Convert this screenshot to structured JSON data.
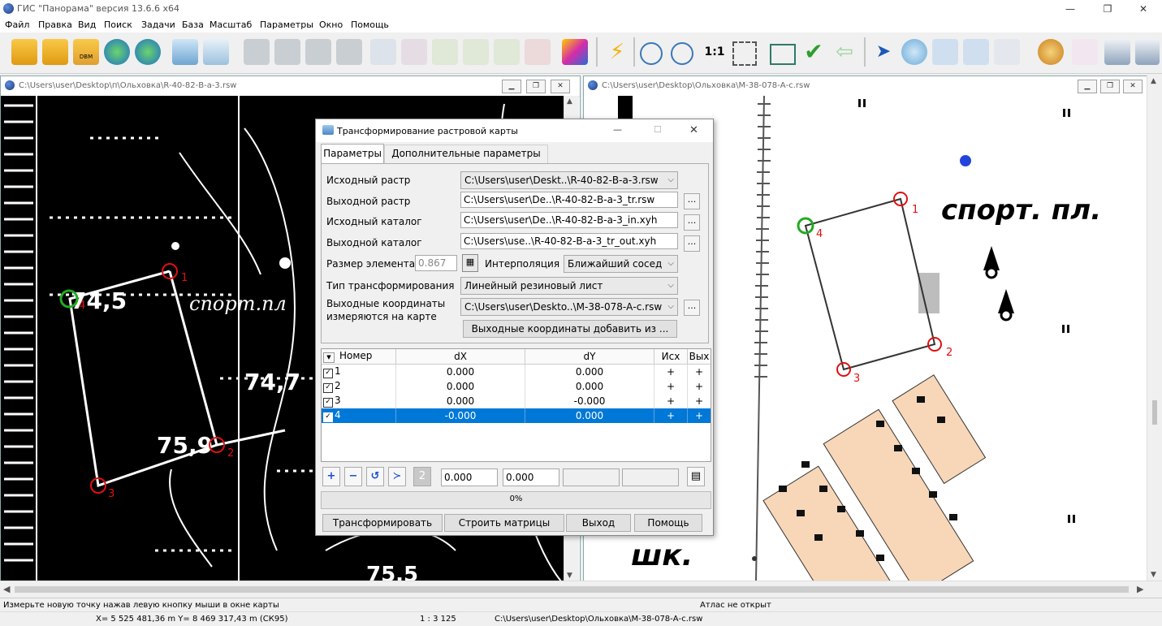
{
  "window": {
    "title": "ГИС \"Панорама\" версия 13.6.6 x64",
    "controls": [
      "—",
      "❐",
      "✕"
    ]
  },
  "menu": [
    "Файл",
    "Правка",
    "Вид",
    "Поиск",
    "Задачи",
    "База",
    "Масштаб",
    "Параметры",
    "Окно",
    "Помощь"
  ],
  "toolbar": {
    "scale_label": "1:1",
    "icons": [
      "open-folder-icon",
      "open-project-icon",
      "dbm-icon",
      "globe-refresh-icon",
      "globe-add-icon",
      "layers-icon",
      "tree-list-icon",
      "binoculars-icon",
      "binoculars-a-icon",
      "binoculars-dots-icon",
      "binoculars-2-icon",
      "list-icon",
      "select-object-icon",
      "select-move-icon",
      "add-point-icon",
      "edit-object-icon",
      "delete-object-icon",
      "cube-icon",
      "lightning-icon",
      "zoom-out-icon",
      "zoom-in-icon",
      "zoom-frame-icon",
      "window-icon",
      "check-icon",
      "back-arrow-icon",
      "pointer-icon",
      "globe-map-icon",
      "frame-list-icon",
      "dbm-frame-icon",
      "text-frame-icon",
      "palette-icon",
      "route-icon",
      "print-icon",
      "print2-icon"
    ]
  },
  "left_window": {
    "title": "C:\\Users\\user\\Desktop\\п\\Ольховка\\R-40-82-В-а-3.rsw",
    "labels": [
      "74,5",
      "74,7",
      "75,9",
      "спорт.пл",
      "75.5"
    ],
    "point_labels": [
      "1",
      "2",
      "3",
      "4"
    ]
  },
  "right_window": {
    "title": "C:\\Users\\user\\Desktop\\Ольховка\\M-38-078-А-с.rsw",
    "labels": [
      "спорт. пл.",
      "шк."
    ],
    "point_labels": [
      "1",
      "2",
      "3",
      "4"
    ]
  },
  "dialog": {
    "title": "Трансформирование растровой карты",
    "controls": [
      "—",
      "☐",
      "✕"
    ],
    "tabs": [
      "Параметры",
      "Дополнительные параметры"
    ],
    "rows": {
      "src_raster_label": "Исходный растр",
      "src_raster_value": "C:\\Users\\user\\Deskt..\\R-40-82-В-а-3.rsw",
      "out_raster_label": "Выходной растр",
      "out_raster_value": "C:\\Users\\user\\De..\\R-40-82-В-а-3_tr.rsw",
      "src_catalog_label": "Исходный каталог",
      "src_catalog_value": "C:\\Users\\user\\De..\\R-40-82-В-а-3_in.xyh",
      "out_catalog_label": "Выходной каталог",
      "out_catalog_value": "C:\\Users\\use..\\R-40-82-В-а-3_tr_out.xyh",
      "elem_size_label": "Размер элемента",
      "elem_size_value": "0.867",
      "interp_label": "Интерполяция",
      "interp_value": "Ближайший сосед",
      "transform_type_label": "Тип трансформирования",
      "transform_type_value": "Линейный резиновый лист",
      "out_coords_label_1": "Выходные координаты",
      "out_coords_label_2": "измеряются на карте",
      "out_coords_value": "C:\\Users\\user\\Deskto..\\M-38-078-А-с.rsw",
      "add_from_button": "Выходные координаты добавить из ...",
      "dots": "..."
    },
    "table": {
      "columns": [
        "Номер",
        "dX",
        "dY",
        "Исх",
        "Вых"
      ],
      "rows": [
        {
          "num": "1",
          "dx": "0.000",
          "dy": "0.000",
          "src": "+",
          "out": "+",
          "checked": true,
          "selected": false
        },
        {
          "num": "2",
          "dx": "0.000",
          "dy": "0.000",
          "src": "+",
          "out": "+",
          "checked": true,
          "selected": false
        },
        {
          "num": "3",
          "dx": "0.000",
          "dy": "-0.000",
          "src": "+",
          "out": "+",
          "checked": true,
          "selected": false
        },
        {
          "num": "4",
          "dx": "-0.000",
          "dy": "0.000",
          "src": "+",
          "out": "+",
          "checked": true,
          "selected": true
        }
      ]
    },
    "bottom_tools": {
      "add": "+",
      "remove": "−",
      "undo": "↺",
      "split": "≻",
      "num": "2",
      "field_1": "0.000",
      "field_2": "0.000"
    },
    "progress": "0%",
    "buttons": [
      "Трансформировать",
      "Строить матрицы",
      "Выход",
      "Помощь"
    ]
  },
  "status": {
    "hint": "Измерьте новую точку нажав левую кнопку мыши в окне карты",
    "atlas": "Атлас не открыт",
    "coords": "X= 5 525 481,36 m    Y= 8 469 317,43 m  (СК95)",
    "scale": "1 : 3 125",
    "path": "C:\\Users\\user\\Desktop\\Ольховка\\M-38-078-А-с.rsw"
  },
  "colors": {
    "accent": "#0078d7",
    "marker_red": "#e01010",
    "marker_green": "#22aa22",
    "building": "#f7d7b8"
  }
}
